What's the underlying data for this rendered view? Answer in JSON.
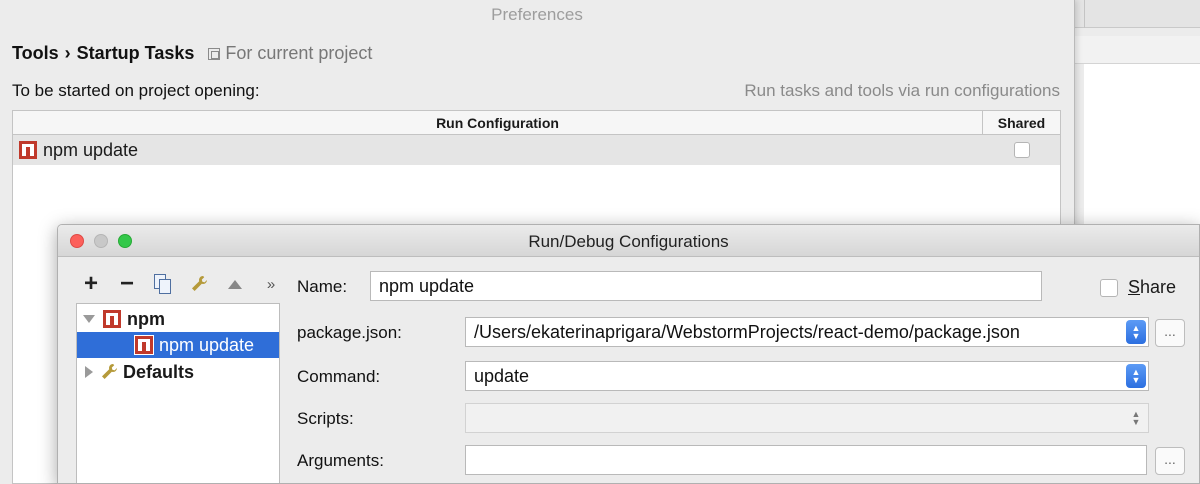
{
  "preferences": {
    "window_title": "Preferences",
    "breadcrumb": {
      "section": "Tools",
      "separator": "›",
      "page": "Startup Tasks",
      "scope": "For current project"
    },
    "started_label": "To be started on project opening:",
    "run_link": "Run tasks and tools via run configurations",
    "table": {
      "columns": [
        "Run Configuration",
        "Shared"
      ],
      "rows": [
        {
          "name": "npm update",
          "shared": false
        }
      ]
    }
  },
  "dialog": {
    "title": "Run/Debug Configurations",
    "toolbar": {
      "add": "+",
      "remove": "−",
      "more": "»"
    },
    "tree": {
      "group": "npm",
      "item": "npm update",
      "defaults": "Defaults"
    },
    "form": {
      "name_label": "Name:",
      "name_value": "npm update",
      "share_label": "Share",
      "share_checked": false,
      "package_label": "package.json:",
      "package_value": "/Users/ekaterinaprigara/WebstormProjects/react-demo/package.json",
      "command_label": "Command:",
      "command_value": "update",
      "scripts_label": "Scripts:",
      "scripts_value": "",
      "arguments_label": "Arguments:",
      "arguments_value": "",
      "browse_label": "..."
    }
  }
}
